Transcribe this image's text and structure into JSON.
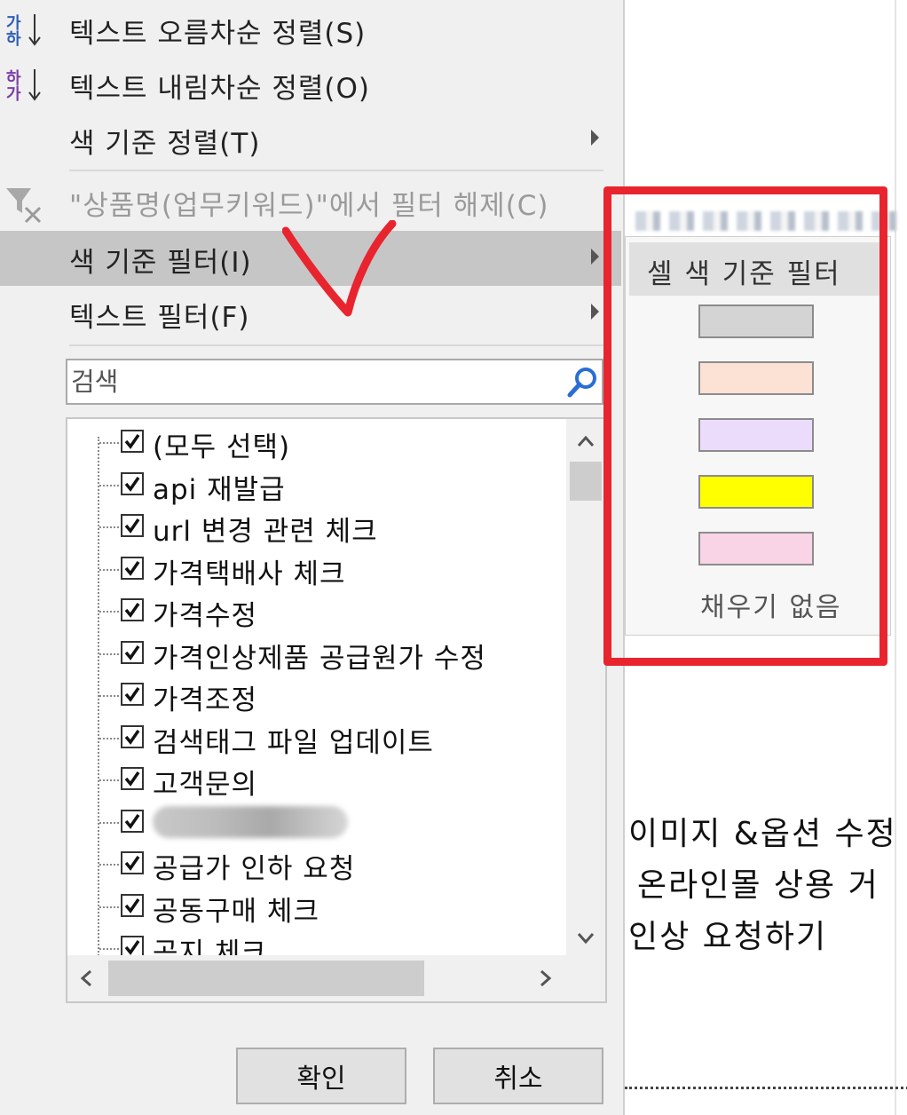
{
  "menu": {
    "sort_asc": "텍스트 오름차순 정렬(S)",
    "sort_desc": "텍스트 내림차순 정렬(O)",
    "sort_by_color": "색 기준 정렬(T)",
    "clear_filter": "\"상품명(업무키워드)\"에서 필터 해제(C)",
    "filter_by_color": "색 기준 필터(I)",
    "text_filter": "텍스트 필터(F)"
  },
  "search": {
    "placeholder": "검색"
  },
  "list_items": [
    "(모두 선택)",
    "api 재발급",
    "url 변경 관련 체크",
    "가격택배사 체크",
    "가격수정",
    "가격인상제품 공급원가 수정",
    "가격조정",
    "검색태그 파일 업데이트",
    "고객문의",
    "",
    "공급가 인하 요청",
    "공동구매 체크",
    "공지 체크"
  ],
  "buttons": {
    "ok": "확인",
    "cancel": "취소"
  },
  "submenu": {
    "title": "셀 색 기준 필터",
    "swatches": [
      "#d4d4d4",
      "#fbe2d5",
      "#ecdcfc",
      "#ffff00",
      "#f9d4e6"
    ],
    "no_fill": "채우기 없음"
  },
  "sheet": {
    "line1": "이미지 &옵션 수정",
    "line2": "온라인몰 상용 거",
    "line3": "인상 요청하기"
  },
  "colors": {
    "annotation": "#e8242f",
    "highlight": "#c6c6c6"
  }
}
